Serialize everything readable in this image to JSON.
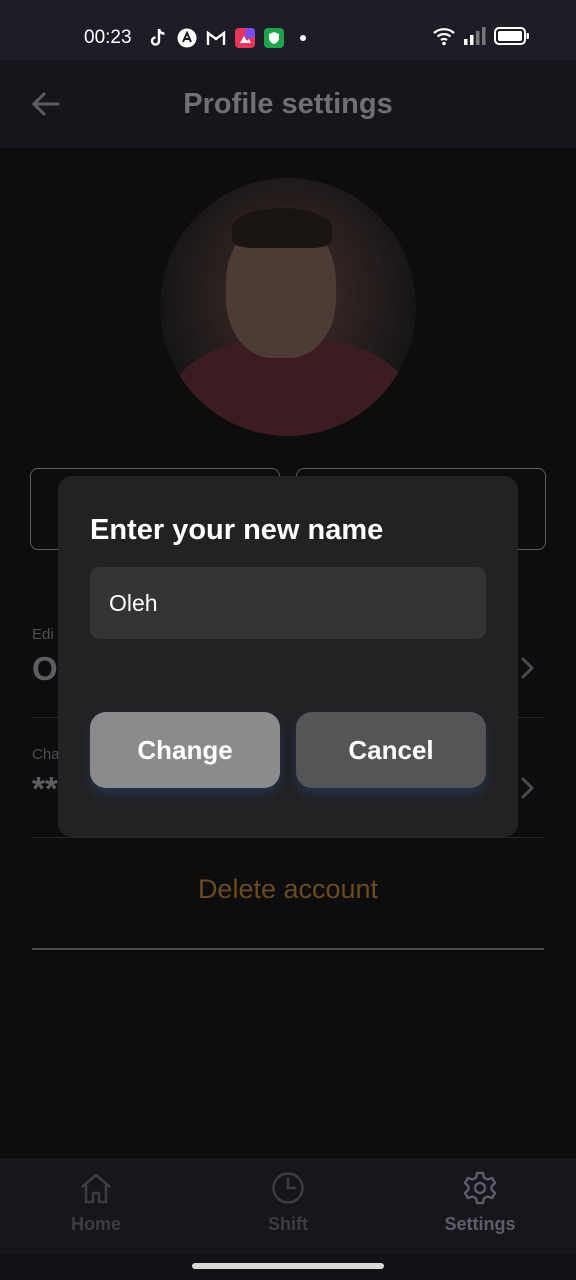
{
  "status_bar": {
    "time": "00:23",
    "app_icons": [
      "tiktok-icon",
      "arrow-app-icon",
      "gmail-icon",
      "photos-app-icon",
      "vpn-shield-icon",
      "dot-icon"
    ],
    "right_icons": [
      "wifi-icon",
      "signal-icon",
      "battery-icon"
    ]
  },
  "header": {
    "title": "Profile settings",
    "back_icon": "back-arrow-icon"
  },
  "profile": {
    "name_row": {
      "label": "Edi",
      "value": "O"
    },
    "password_row": {
      "label": "Cha",
      "value": "**"
    },
    "delete_label": "Delete account"
  },
  "dialog": {
    "title": "Enter your new name",
    "name_value": "Oleh",
    "change_label": "Change",
    "cancel_label": "Cancel"
  },
  "bottom_nav": {
    "items": [
      {
        "label": "Home",
        "icon": "home-icon"
      },
      {
        "label": "Shift",
        "icon": "clock-icon"
      },
      {
        "label": "Settings",
        "icon": "gear-icon"
      }
    ],
    "active": "Settings"
  },
  "colors": {
    "dialog_bg": "#222224",
    "change_button": "#8b8b8d",
    "cancel_button": "#555557",
    "delete_link": "#6a4a1f"
  }
}
